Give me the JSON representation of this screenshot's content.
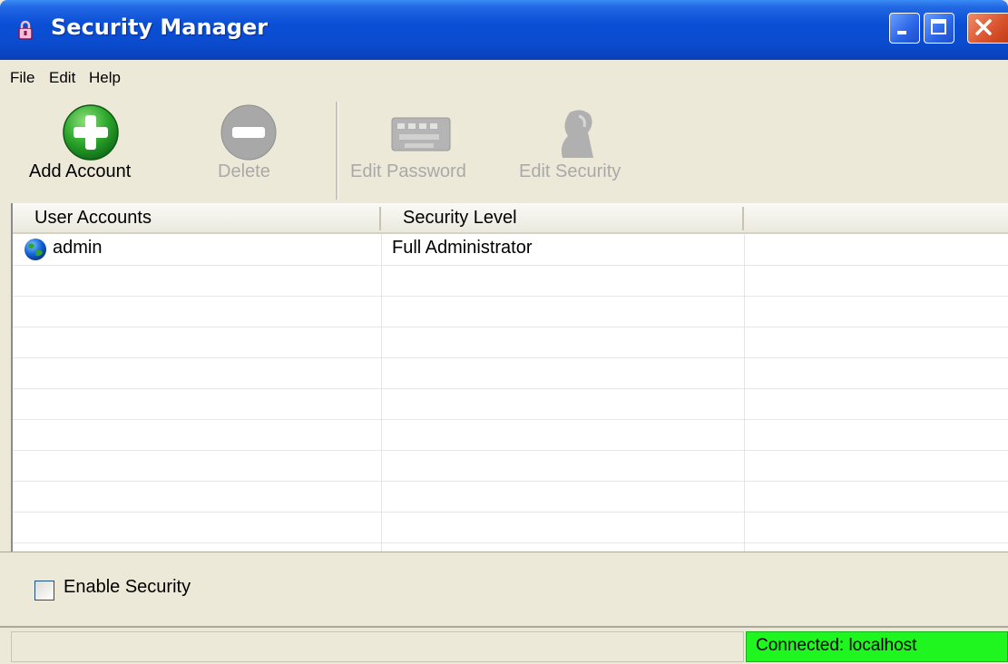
{
  "window": {
    "title": "Security Manager",
    "controls": [
      "minimize",
      "maximize",
      "close"
    ]
  },
  "menu": {
    "items": [
      "File",
      "Edit",
      "Help"
    ]
  },
  "toolbar": {
    "buttons": [
      {
        "label": "Add Account",
        "icon": "add-icon",
        "enabled": true
      },
      {
        "label": "Delete",
        "icon": "minus-icon",
        "enabled": false
      },
      {
        "label": "Edit Password",
        "icon": "keyboard-icon",
        "enabled": false
      },
      {
        "label": "Edit Security",
        "icon": "user-security-icon",
        "enabled": false
      }
    ]
  },
  "table": {
    "columns": [
      "User Accounts",
      "Security Level",
      ""
    ],
    "rows": [
      {
        "account": "admin",
        "level": "Full Administrator",
        "icon": "globe-icon"
      }
    ]
  },
  "options": {
    "enable_security_label": "Enable Security",
    "enable_security_checked": false
  },
  "status": {
    "connection": "Connected: localhost",
    "connection_color": "#1ff51f"
  }
}
